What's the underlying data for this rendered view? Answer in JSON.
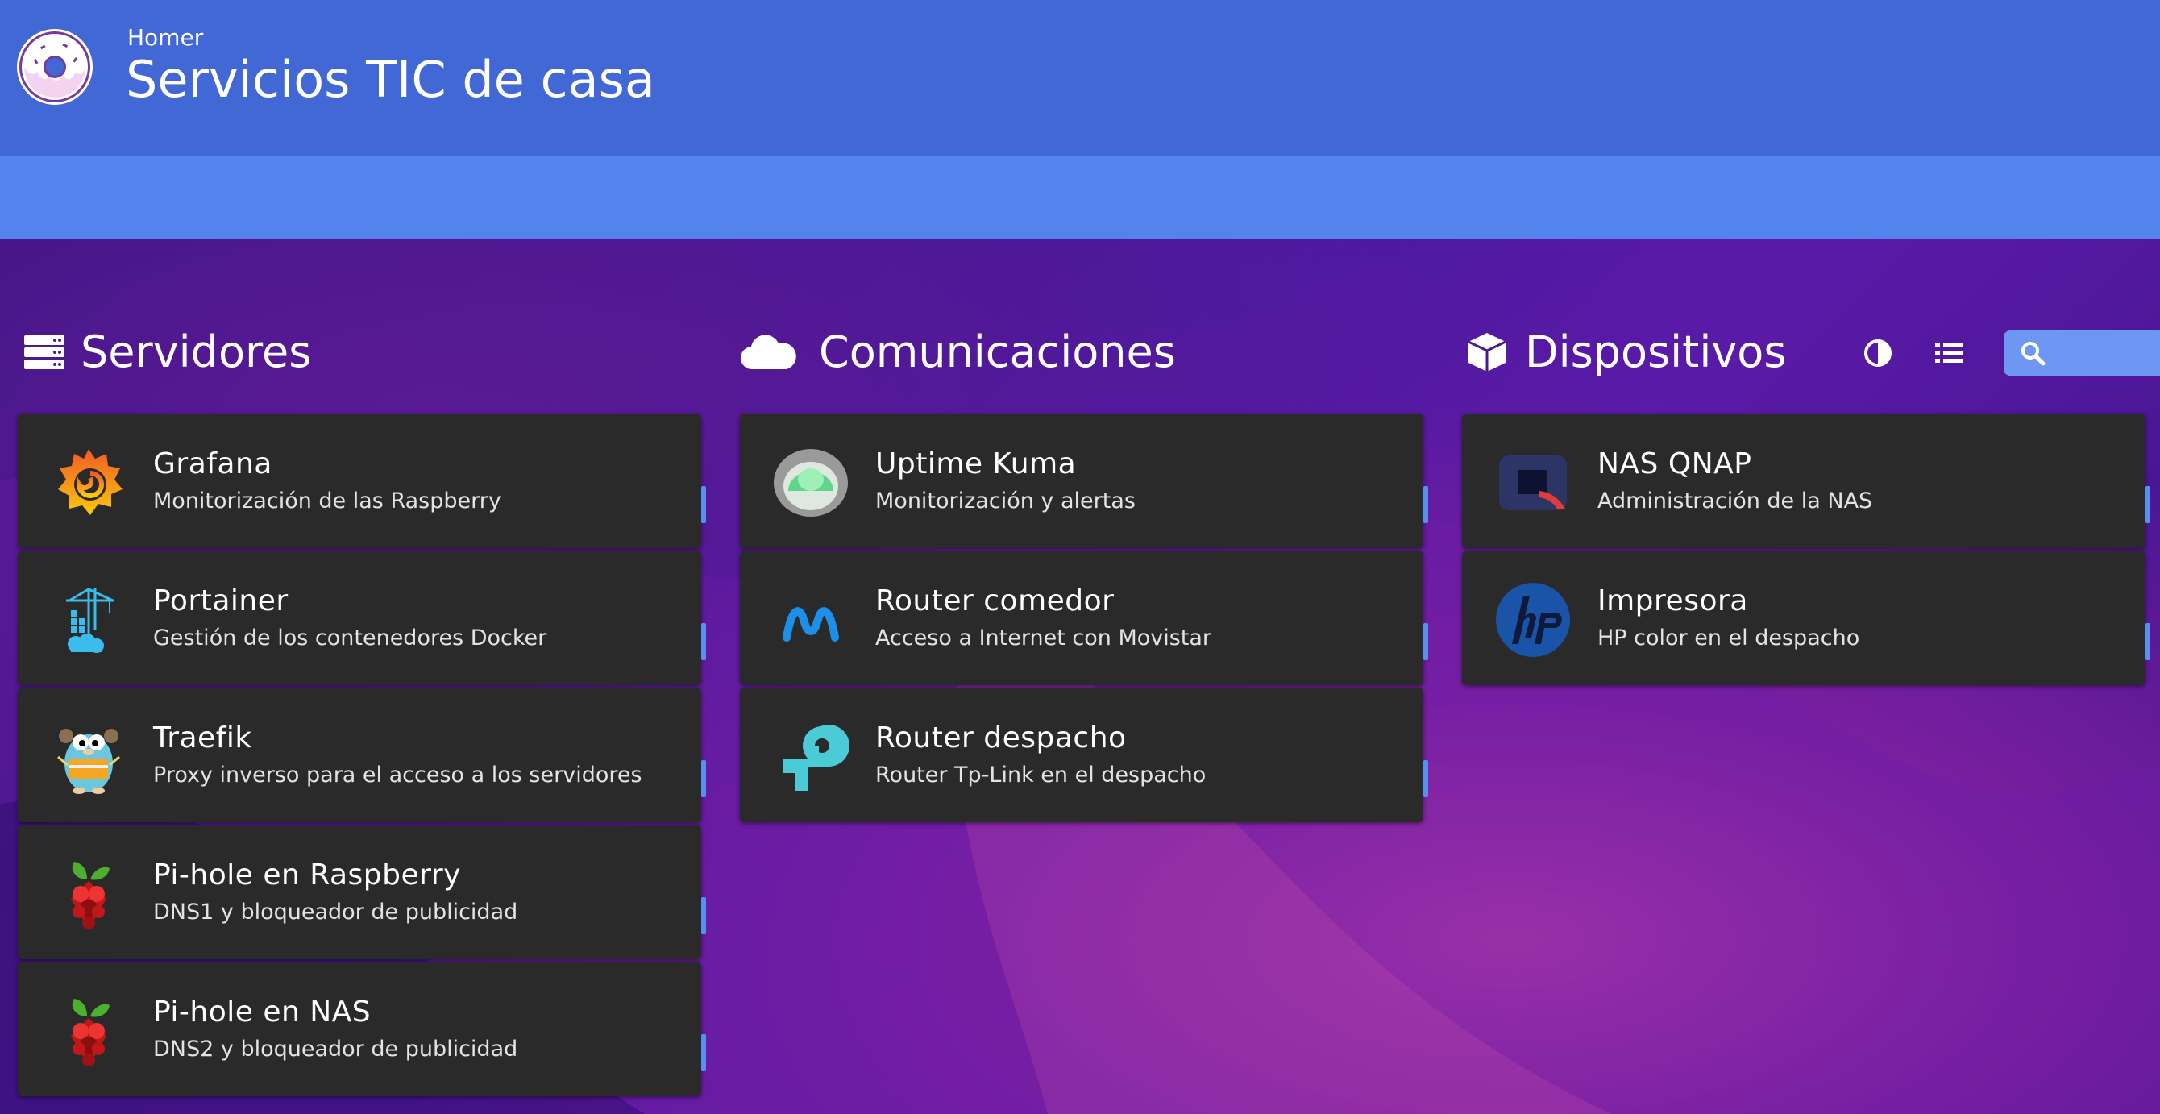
{
  "header": {
    "subtitle": "Homer",
    "title": "Servicios TIC de casa",
    "logo_icon": "donut-logo-icon"
  },
  "navbar": {
    "buttons": [
      {
        "name": "theme-toggle",
        "icon": "contrast-icon"
      },
      {
        "name": "layout-toggle",
        "icon": "list-icon"
      }
    ],
    "search": {
      "icon": "search-icon",
      "value": "",
      "placeholder": ""
    }
  },
  "colors": {
    "header_bg": "#4168d4",
    "navbar_bg": "#5383ec",
    "card_bg": "#2a2a2a",
    "tag_accent": "#5a8ff2"
  },
  "groups": [
    {
      "name": "Servidores",
      "icon": "server-icon",
      "items": [
        {
          "name": "Grafana",
          "subtitle": "Monitorización de las Raspberry",
          "icon": "grafana-icon"
        },
        {
          "name": "Portainer",
          "subtitle": "Gestión de los contenedores Docker",
          "icon": "portainer-icon"
        },
        {
          "name": "Traefik",
          "subtitle": "Proxy inverso para el acceso a los servidores",
          "icon": "traefik-icon"
        },
        {
          "name": "Pi-hole en Raspberry",
          "subtitle": "DNS1 y bloqueador de publicidad",
          "icon": "pihole-icon"
        },
        {
          "name": "Pi-hole en NAS",
          "subtitle": "DNS2 y bloqueador de publicidad",
          "icon": "pihole-icon"
        }
      ]
    },
    {
      "name": "Comunicaciones",
      "icon": "cloud-icon",
      "items": [
        {
          "name": "Uptime Kuma",
          "subtitle": "Monitorización y alertas",
          "icon": "uptime-kuma-icon"
        },
        {
          "name": "Router comedor",
          "subtitle": "Acceso a Internet con Movistar",
          "icon": "movistar-icon"
        },
        {
          "name": "Router despacho",
          "subtitle": "Router Tp-Link en el despacho",
          "icon": "tplink-icon"
        }
      ]
    },
    {
      "name": "Dispositivos",
      "icon": "cube-icon",
      "items": [
        {
          "name": "NAS QNAP",
          "subtitle": "Administración de la NAS",
          "icon": "qnap-icon"
        },
        {
          "name": "Impresora",
          "subtitle": "HP color en el despacho",
          "icon": "hp-icon"
        }
      ]
    }
  ]
}
